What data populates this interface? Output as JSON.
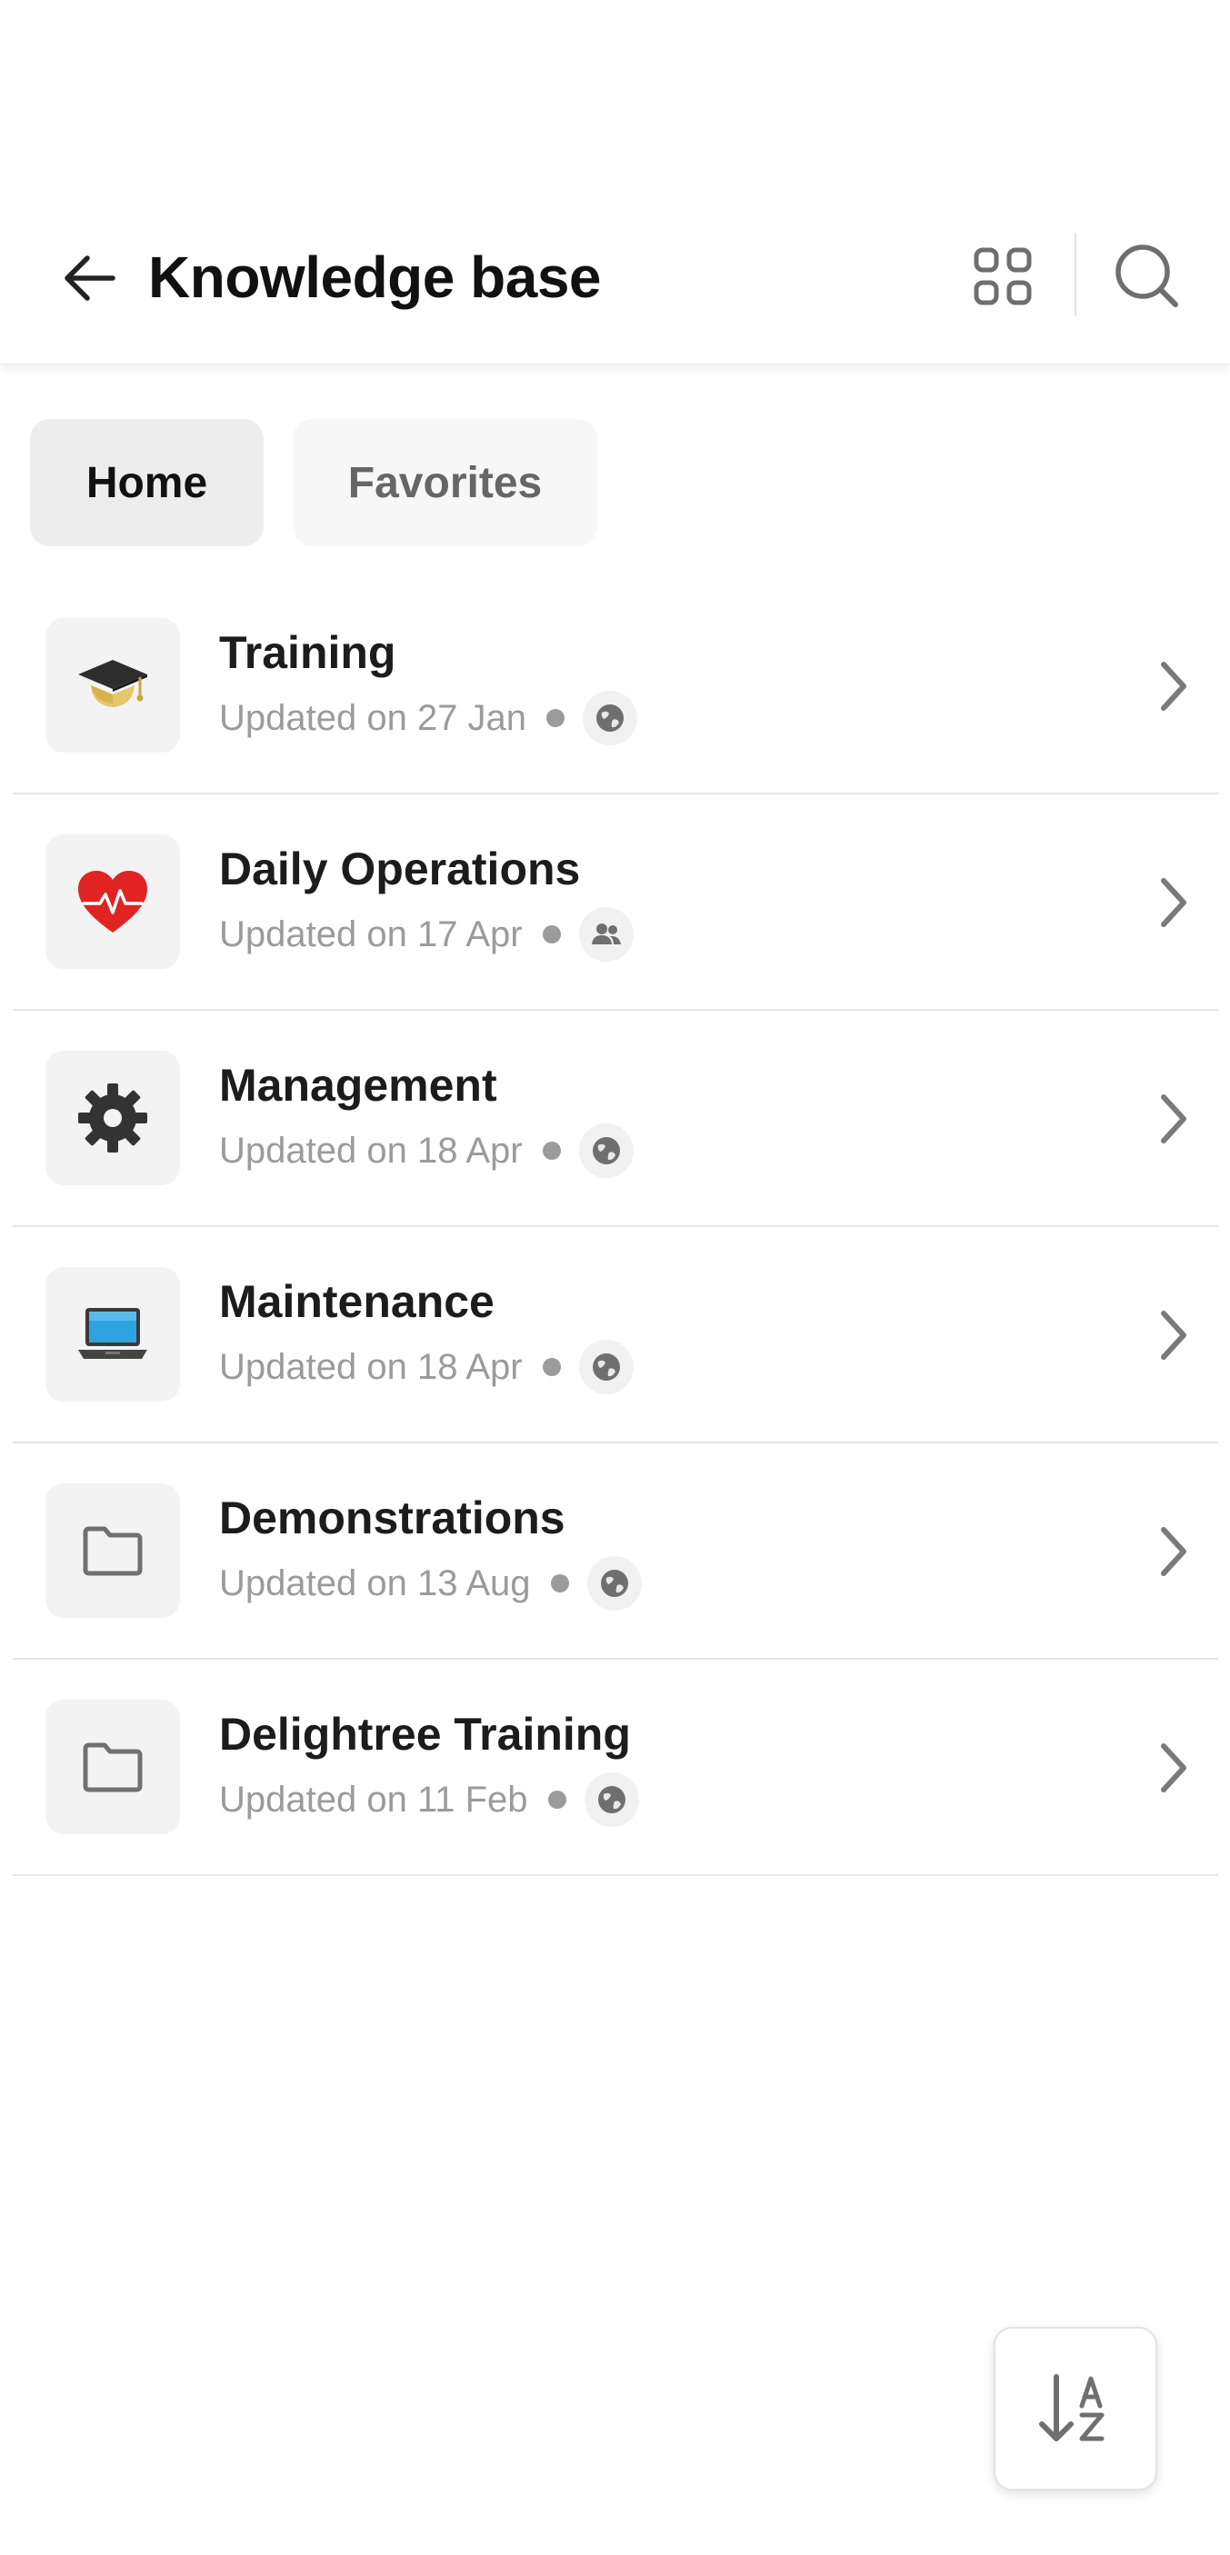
{
  "header": {
    "title": "Knowledge base",
    "back_icon": "arrow-left-icon",
    "grid_icon": "grid-view-icon",
    "search_icon": "search-icon"
  },
  "tabs": [
    {
      "label": "Home",
      "selected": true
    },
    {
      "label": "Favorites",
      "selected": false
    }
  ],
  "items": [
    {
      "title": "Training",
      "updated": "Updated on 27 Jan",
      "icon": "graduation-cap-icon",
      "visibility": "public-globe-icon"
    },
    {
      "title": "Daily Operations",
      "updated": "Updated on 17 Apr",
      "icon": "heart-pulse-icon",
      "visibility": "group-people-icon"
    },
    {
      "title": "Management",
      "updated": "Updated on 18 Apr",
      "icon": "gear-icon",
      "visibility": "public-globe-icon"
    },
    {
      "title": "Maintenance",
      "updated": "Updated on 18 Apr",
      "icon": "laptop-icon",
      "visibility": "public-globe-icon"
    },
    {
      "title": "Demonstrations",
      "updated": "Updated on 13 Aug",
      "icon": "folder-icon",
      "visibility": "public-globe-icon"
    },
    {
      "title": "Delightree Training",
      "updated": "Updated on 11 Feb",
      "icon": "folder-icon",
      "visibility": "public-globe-icon"
    }
  ],
  "sort_button": {
    "icon": "sort-a-z-icon"
  },
  "colors": {
    "text_primary": "#1c1c1c",
    "text_secondary": "#9b9b9b",
    "tab_selected_bg": "#ededed",
    "icon_gray": "#707070"
  }
}
